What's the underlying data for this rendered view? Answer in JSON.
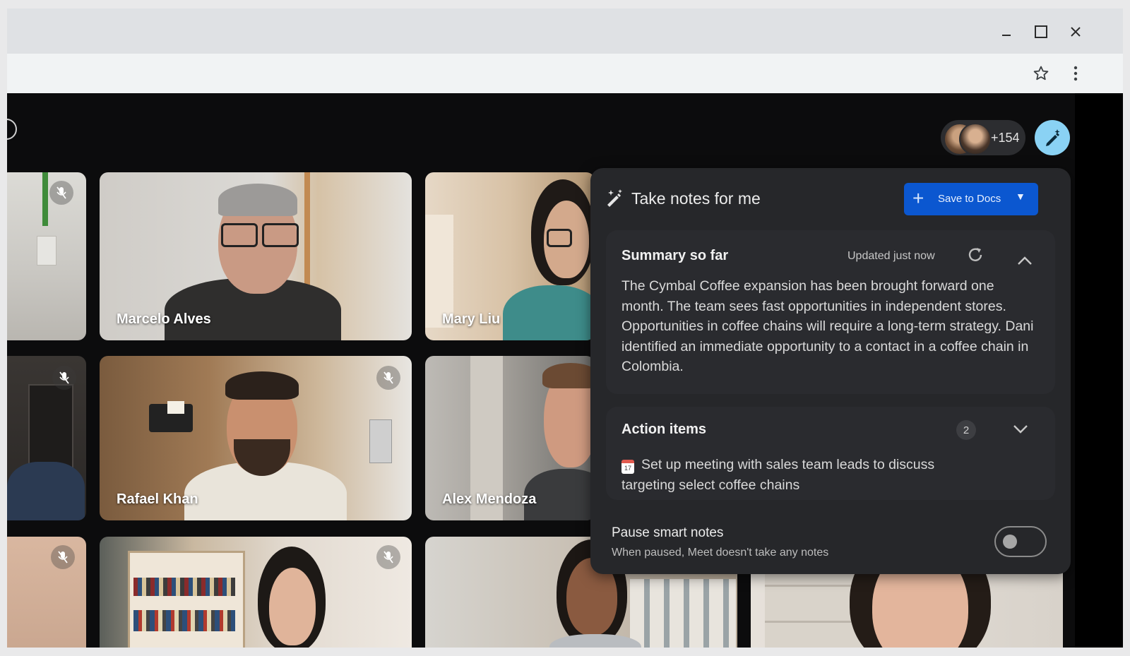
{
  "header": {
    "participant_count": "+154"
  },
  "tiles": [
    {
      "name": ""
    },
    {
      "name": "Marcelo Alves"
    },
    {
      "name": "Mary Liu"
    },
    {
      "name": ""
    },
    {
      "name": "Rafael Khan"
    },
    {
      "name": "Alex Mendoza"
    },
    {
      "name": ""
    },
    {
      "name": ""
    },
    {
      "name": ""
    },
    {
      "name": ""
    }
  ],
  "panel": {
    "title": "Take notes for me",
    "save_label": "Save to Docs",
    "summary": {
      "title": "Summary so far",
      "updated": "Updated just now",
      "text": "The Cymbal Coffee expansion has been brought forward one month. The team sees fast opportunities in independent stores. Opportunities in coffee chains will require a long-term strategy. Dani identified an immediate opportunity to a contact in a coffee chain in Colombia."
    },
    "actions": {
      "title": "Action items",
      "count": "2",
      "calendar_day": "17",
      "items": [
        {
          "text": "Set up meeting with sales team leads to discuss targeting select coffee chains"
        }
      ]
    },
    "pause": {
      "title": "Pause smart notes",
      "subtitle": "When paused, Meet doesn't take any notes",
      "enabled": false
    }
  },
  "colors": {
    "accent": "#0b57d0",
    "fab": "#8ad2f4",
    "panel": "#26272a"
  },
  "icons": [
    "minimize-icon",
    "maximize-icon",
    "close-icon",
    "star-icon",
    "kebab-menu-icon",
    "pencil-sparkle-icon",
    "plus-icon",
    "caret-down-icon",
    "refresh-icon",
    "chevron-up-icon",
    "chevron-down-icon",
    "mic-off-icon",
    "calendar-icon"
  ]
}
